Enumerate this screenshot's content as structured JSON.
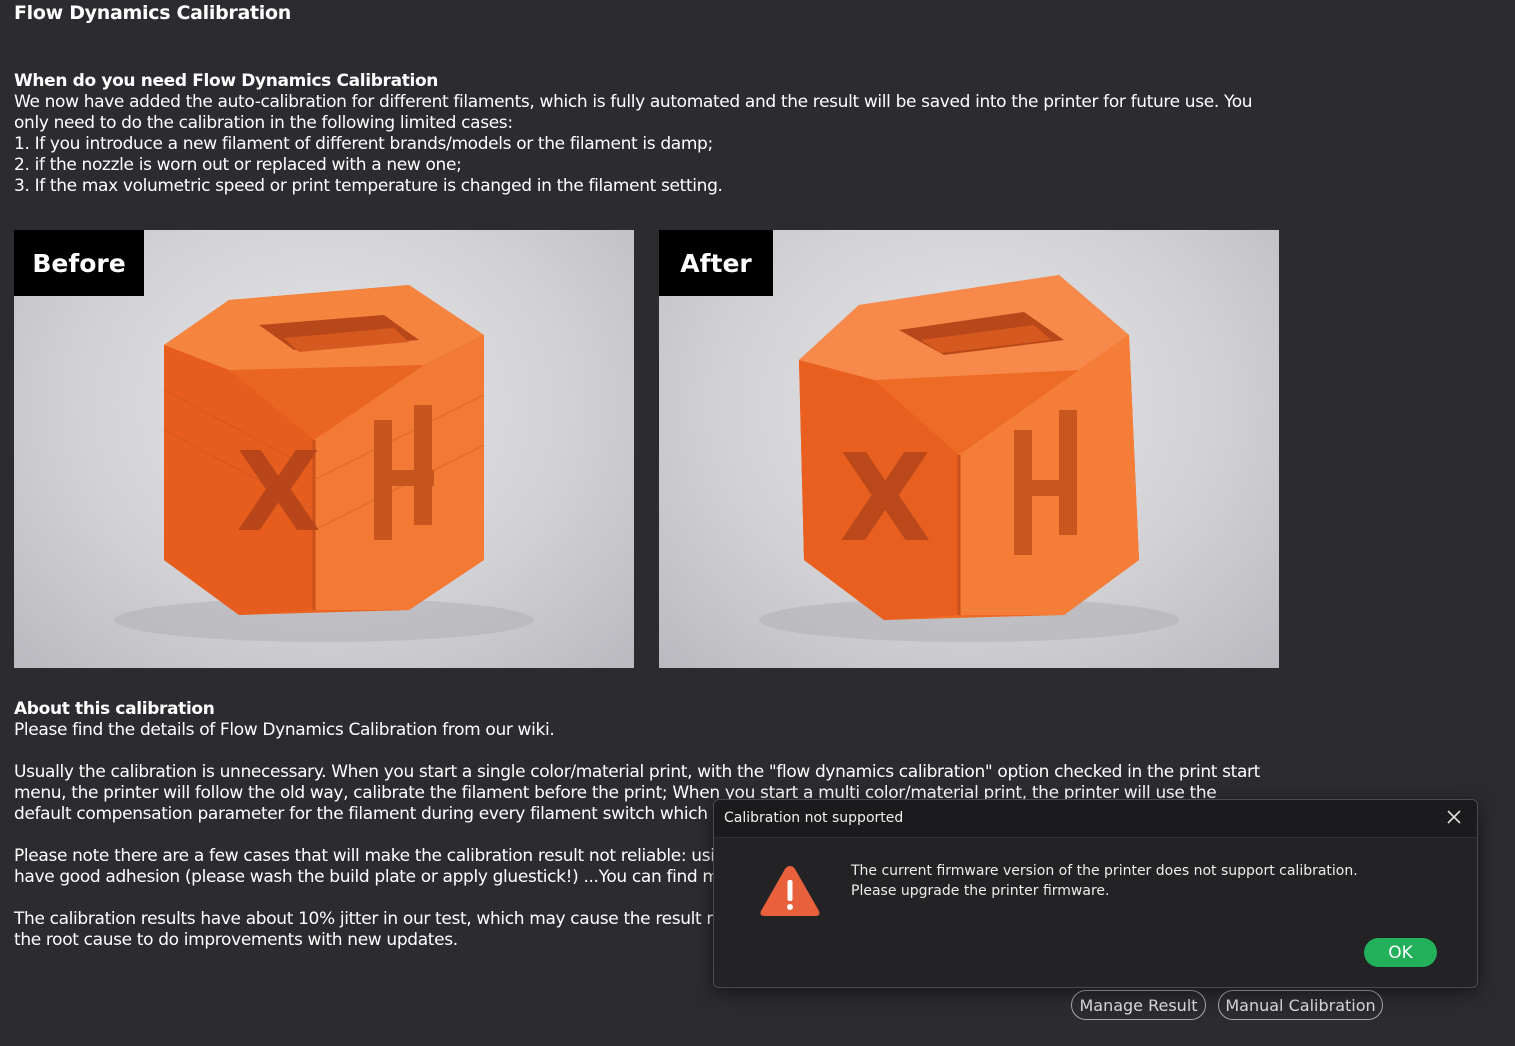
{
  "page": {
    "title": "Flow Dynamics Calibration"
  },
  "when": {
    "heading": "When do you need Flow Dynamics Calibration",
    "lines": [
      "We now have added the auto-calibration for different filaments, which is fully automated and the result will be saved into the printer for future use. You",
      "only need to do the calibration in the following limited cases:",
      "1. If you introduce a new filament of different brands/models or the filament is damp;",
      "2. if the nozzle is worn out or replaced with a new one;",
      "3. If the max volumetric speed or print temperature is changed in the filament setting."
    ]
  },
  "images": {
    "before_label": "Before",
    "after_label": "After",
    "before_face_glyph": "X",
    "after_face_glyph": "X"
  },
  "about": {
    "heading": "About this calibration",
    "line1": "Please find the details of Flow Dynamics Calibration from our wiki.",
    "para2": [
      "Usually the calibration is unnecessary. When you start a single color/material print, with the \"flow dynamics calibration\" option checked in the print start",
      "menu, the printer will follow the old way, calibrate the filament before the print; When you start a multi color/material print, the printer will use the",
      "default compensation parameter for the filament during every filament switch which w"
    ],
    "para3": [
      "Please note there are a few cases that will make the calibration result not reliable: usin",
      "have good adhesion (please wash the build plate or apply gluestick!) ...You can find mo"
    ],
    "para4": [
      "The calibration results have about 10% jitter in our test, which may cause the result no",
      "the root cause to do improvements with new updates."
    ]
  },
  "buttons": {
    "manage_result": "Manage Result",
    "manual_calibration": "Manual Calibration"
  },
  "dialog": {
    "title": "Calibration not supported",
    "message_line1": "The current firmware version of the printer does not support calibration.",
    "message_line2": "Please upgrade the printer firmware.",
    "ok_label": "OK",
    "close_icon": "close-icon",
    "warning_icon": "warning-triangle-icon",
    "warning_color": "#e8613c",
    "ok_color": "#22b05a"
  },
  "colors": {
    "background": "#2c2c30",
    "filament_orange": "#f0702a"
  }
}
